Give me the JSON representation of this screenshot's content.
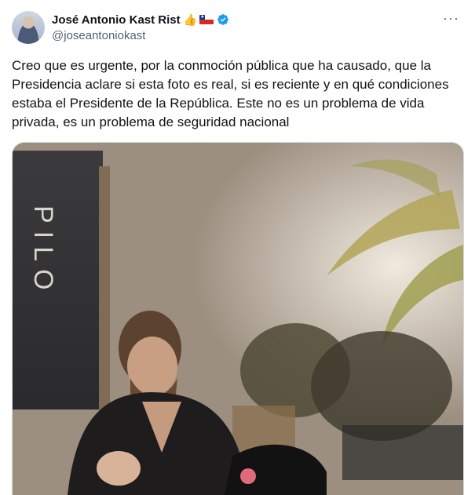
{
  "tweet": {
    "author": {
      "display_name": "José Antonio Kast Rist",
      "handle": "@joseantoniokast",
      "badges": [
        "thumbs-up-emoji",
        "chile-flag-emoji",
        "verified-badge"
      ]
    },
    "more_label": "···",
    "text": "Creo que es urgente, por la conmoción pública que ha causado, que la Presidencia aclare si esta foto es real, si es reciente y en qué condiciones estaba el Presidente de la República. Este no es un problema de vida privada, es un problema de seguridad nacional",
    "media": {
      "type": "photo",
      "sign_text": "PILO"
    }
  },
  "colors": {
    "text_primary": "#0f1419",
    "text_secondary": "#536471",
    "verified_blue": "#1d9bf0",
    "border": "#cfd9de"
  }
}
